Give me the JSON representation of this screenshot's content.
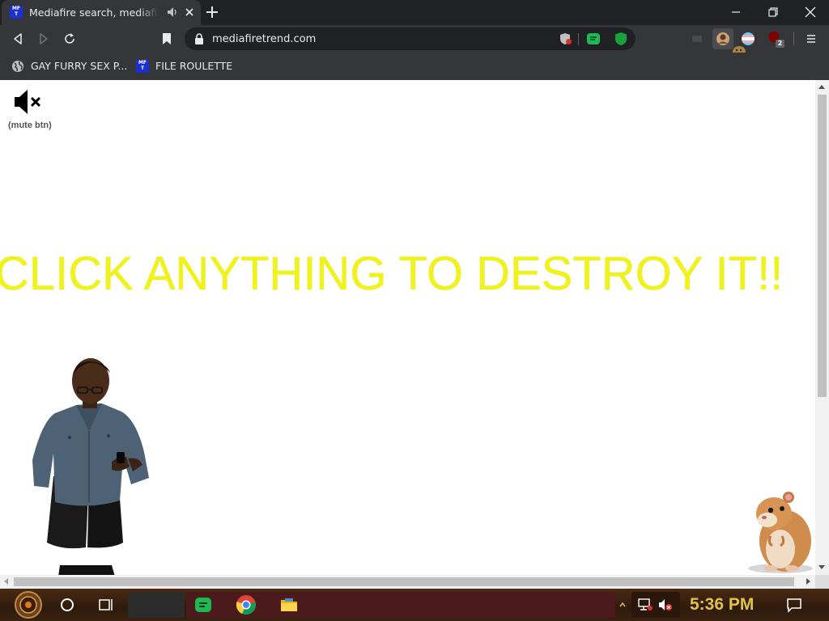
{
  "tab": {
    "favicon_text": "MF T",
    "title": "Mediafire search, mediafire"
  },
  "toolbar": {
    "url": "mediafiretrend.com",
    "extension_badge": "2"
  },
  "bookmarks": [
    {
      "label": "GAY FURRY SEX P..."
    },
    {
      "label": "FILE ROULETTE",
      "favicon_text": "MF T"
    }
  ],
  "page": {
    "mute_label": "(mute btn)",
    "headline": "CLICK ANYTHING TO DESTROY IT!!"
  },
  "taskbar": {
    "clock": "5:36 PM"
  },
  "colors": {
    "headline": "#f0f21c",
    "chrome_dark": "#202124",
    "chrome_toolbar": "#35363a",
    "clock": "#e0c24a"
  }
}
